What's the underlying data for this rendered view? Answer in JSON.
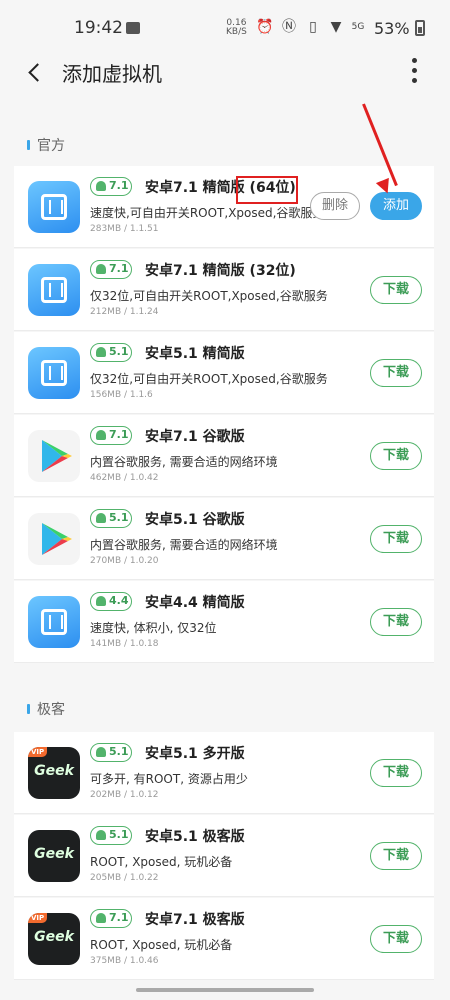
{
  "status_bar": {
    "time": "19:42",
    "net_speed_value": "0.16",
    "net_speed_unit": "KB/S",
    "network": "5G",
    "battery": "53%"
  },
  "header": {
    "title": "添加虚拟机"
  },
  "sections": [
    {
      "label": "官方"
    },
    {
      "label": "极客"
    }
  ],
  "apps": [
    {
      "icon": "vm-cube-icon",
      "version": "7.1",
      "name": "安卓7.1 精简版 (64位)",
      "desc": "速度快,可自由开关ROOT,Xposed,谷歌服务",
      "meta": "283MB / 1.1.51",
      "action_secondary": "删除",
      "action": "添加"
    },
    {
      "icon": "vm-cube-icon",
      "version": "7.1",
      "name": "安卓7.1 精简版 (32位)",
      "desc": "仅32位,可自由开关ROOT,Xposed,谷歌服务",
      "meta": "212MB / 1.1.24",
      "action": "下载"
    },
    {
      "icon": "vm-cube-icon",
      "version": "5.1",
      "name": "安卓5.1 精简版",
      "desc": "仅32位,可自由开关ROOT,Xposed,谷歌服务",
      "meta": "156MB / 1.1.6",
      "action": "下载"
    },
    {
      "icon": "google-play-icon",
      "version": "7.1",
      "name": "安卓7.1 谷歌版",
      "desc": "内置谷歌服务, 需要合适的网络环境",
      "meta": "462MB / 1.0.42",
      "action": "下载"
    },
    {
      "icon": "google-play-icon",
      "version": "5.1",
      "name": "安卓5.1 谷歌版",
      "desc": "内置谷歌服务, 需要合适的网络环境",
      "meta": "270MB / 1.0.20",
      "action": "下载"
    },
    {
      "icon": "vm-cube-icon",
      "version": "4.4",
      "name": "安卓4.4 精简版",
      "desc": "速度快, 体积小, 仅32位",
      "meta": "141MB / 1.0.18",
      "action": "下载"
    },
    {
      "icon": "geek-icon",
      "badge": "VIP",
      "logo": "Geek",
      "version": "5.1",
      "name": "安卓5.1 多开版",
      "desc": "可多开, 有ROOT, 资源占用少",
      "meta": "202MB / 1.0.12",
      "action": "下载"
    },
    {
      "icon": "geek-icon",
      "logo": "Geek",
      "version": "5.1",
      "name": "安卓5.1 极客版",
      "desc": "ROOT, Xposed, 玩机必备",
      "meta": "205MB / 1.0.22",
      "action": "下载"
    },
    {
      "icon": "geek-icon",
      "badge": "VIP",
      "logo": "Geek",
      "version": "7.1",
      "name": "安卓7.1 极客版",
      "desc": "ROOT, Xposed, 玩机必备",
      "meta": "375MB / 1.0.46",
      "action": "下载"
    }
  ],
  "colors": {
    "accent_blue": "#3aa6e8",
    "accent_green": "#52b36b",
    "annotation_red": "#e02020"
  }
}
